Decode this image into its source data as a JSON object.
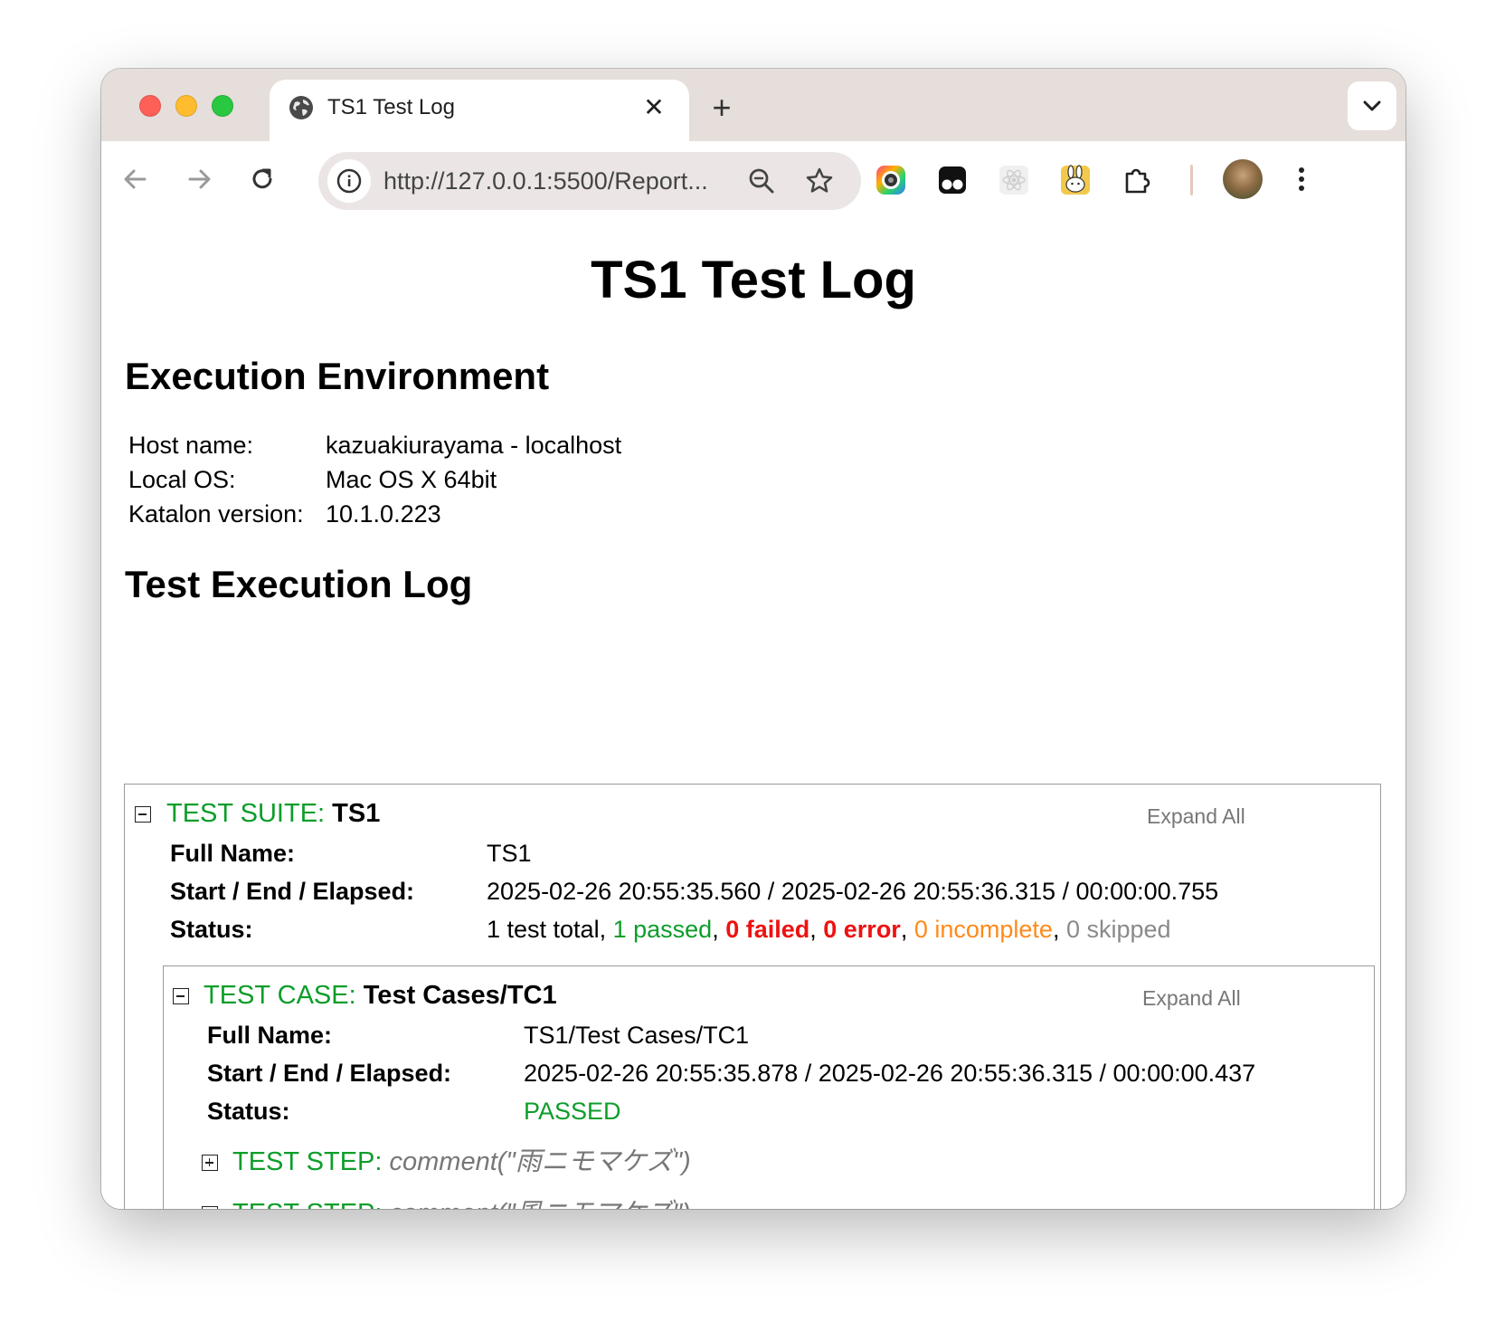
{
  "browser": {
    "tab_title": "TS1 Test Log",
    "close_glyph": "✕",
    "new_tab_glyph": "+",
    "tab_list_glyph": "⌄",
    "url": "http://127.0.0.1:5500/Report..."
  },
  "page": {
    "title": "TS1 Test Log",
    "environment": {
      "heading": "Execution Environment",
      "rows": [
        {
          "label": "Host name:",
          "value": "kazuakiurayama - localhost"
        },
        {
          "label": "Local OS:",
          "value": "Mac OS X 64bit"
        },
        {
          "label": "Katalon version:",
          "value": "10.1.0.223"
        }
      ]
    },
    "log_heading": "Test Execution Log",
    "suite": {
      "kind": "TEST SUITE:",
      "name": "TS1",
      "expand_label": "Expand All",
      "full_name_label": "Full Name:",
      "full_name": "TS1",
      "timing_label": "Start / End / Elapsed:",
      "timing": "2025-02-26 20:55:35.560 / 2025-02-26 20:55:36.315 / 00:00:00.755",
      "status_label": "Status:",
      "status": {
        "total": "1 test total",
        "passed": "1 passed",
        "failed": "0 failed",
        "error": "0 error",
        "incomplete": "0 incomplete",
        "skipped": "0 skipped"
      },
      "test_case": {
        "kind": "TEST CASE:",
        "name": "Test Cases/TC1",
        "expand_label": "Expand All",
        "full_name_label": "Full Name:",
        "full_name": "TS1/Test Cases/TC1",
        "timing_label": "Start / End / Elapsed:",
        "timing": "2025-02-26 20:55:35.878 / 2025-02-26 20:55:36.315 / 00:00:00.437",
        "status_label": "Status:",
        "status": "PASSED",
        "steps": [
          {
            "kind": "TEST STEP:",
            "call": "comment(\"雨ニモマケズ\")"
          },
          {
            "kind": "TEST STEP:",
            "call": "comment(\"風ニモマケズ\")"
          }
        ]
      }
    }
  },
  "colors": {
    "pass_green": "#0d9d2a",
    "fail_red": "#ee1111",
    "incomplete_orange": "#ff8a1a",
    "skipped_grey": "#8a8a8a"
  }
}
